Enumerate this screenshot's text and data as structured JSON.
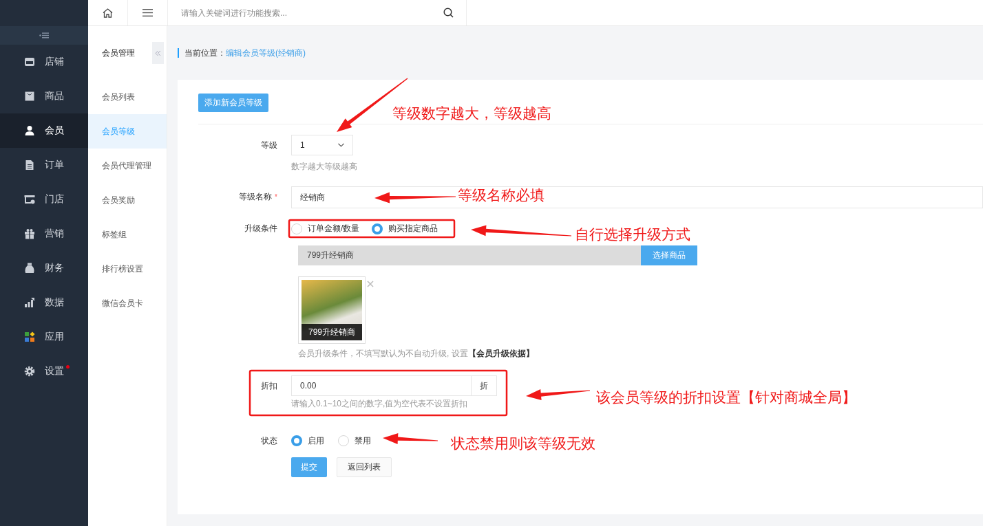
{
  "sidebar": {
    "items": [
      {
        "label": "店铺",
        "selected": false,
        "notify": false
      },
      {
        "label": "商品",
        "selected": false,
        "notify": false
      },
      {
        "label": "会员",
        "selected": true,
        "notify": false
      },
      {
        "label": "订单",
        "selected": false,
        "notify": false
      },
      {
        "label": "门店",
        "selected": false,
        "notify": false
      },
      {
        "label": "营销",
        "selected": false,
        "notify": false
      },
      {
        "label": "财务",
        "selected": false,
        "notify": false
      },
      {
        "label": "数据",
        "selected": false,
        "notify": false
      },
      {
        "label": "应用",
        "selected": false,
        "notify": false
      },
      {
        "label": "设置",
        "selected": false,
        "notify": true
      }
    ]
  },
  "topbar": {
    "search": {
      "placeholder": "请输入关键词进行功能搜索..."
    }
  },
  "submenu": {
    "title": "会员管理",
    "items": [
      {
        "label": "会员列表",
        "selected": false
      },
      {
        "label": "会员等级",
        "selected": true
      },
      {
        "label": "会员代理管理",
        "selected": false
      },
      {
        "label": "会员奖励",
        "selected": false
      },
      {
        "label": "标签组",
        "selected": false
      },
      {
        "label": "排行榜设置",
        "selected": false
      },
      {
        "label": "微信会员卡",
        "selected": false
      }
    ]
  },
  "breadcrumb": {
    "label": "当前位置：",
    "current": "编辑会员等级(经销商)"
  },
  "form": {
    "add_button": "添加新会员等级",
    "level": {
      "label": "等级",
      "value": "1",
      "hint": "数字越大等级越高"
    },
    "name": {
      "label": "等级名称",
      "required_mark": "*",
      "value": "经销商"
    },
    "upgrade": {
      "label": "升级条件",
      "options": [
        {
          "label": "订单金额/数量",
          "selected": false
        },
        {
          "label": "购买指定商品",
          "selected": true
        }
      ],
      "goods_value": "799升经销商",
      "select_button": "选择商品",
      "product_caption": "799升经销商",
      "hint": "会员升级条件，不填写默认为不自动升级, 设置**【会员升级依据】**"
    },
    "discount": {
      "label": "折扣",
      "value": "0.00",
      "suffix": "折",
      "hint": "请输入0.1~10之间的数字,值为空代表不设置折扣"
    },
    "status": {
      "label": "状态",
      "options": [
        {
          "label": "启用",
          "selected": true
        },
        {
          "label": "禁用",
          "selected": false
        }
      ]
    },
    "buttons": [
      {
        "label": "提交",
        "kind": "primary"
      },
      {
        "label": "返回列表",
        "kind": "default"
      }
    ]
  },
  "annotations": [
    {
      "text": "等级数字越大，等级越高"
    },
    {
      "text": "等级名称必填"
    },
    {
      "text": "自行选择升级方式"
    },
    {
      "text": "该会员等级的折扣设置【针对商城全局】"
    },
    {
      "text": "状态禁用则该等级无效"
    }
  ]
}
